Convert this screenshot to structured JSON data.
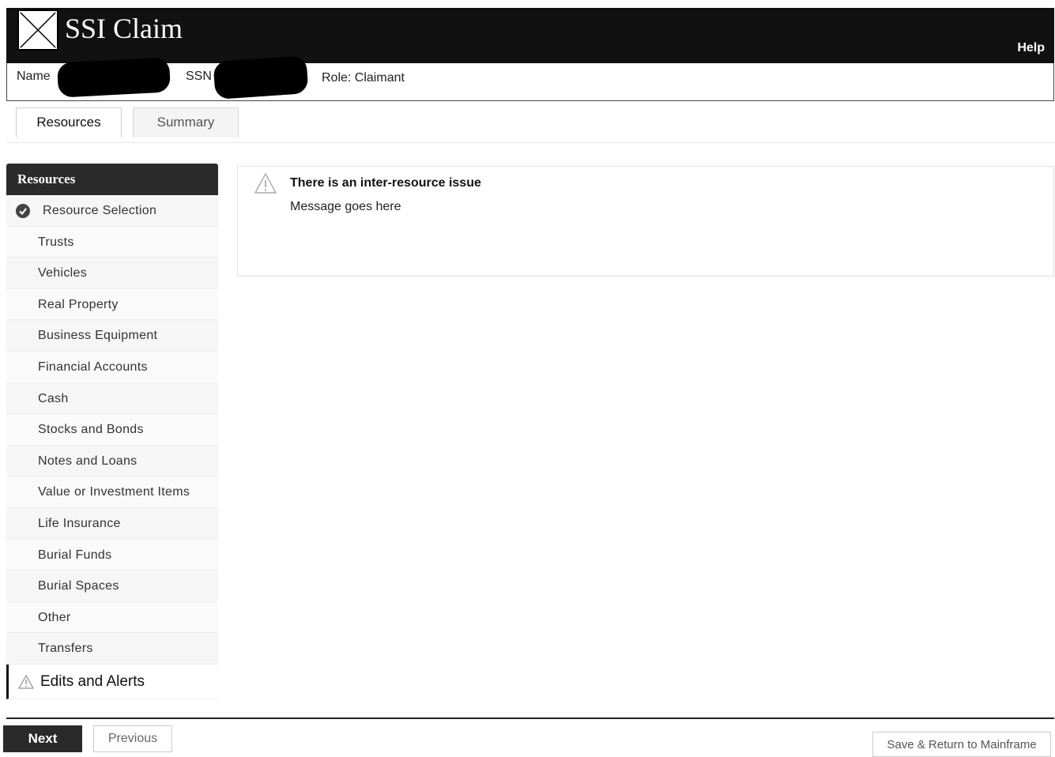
{
  "app": {
    "title": "SSI Claim",
    "help_label": "Help"
  },
  "claimant": {
    "name_label": "Name",
    "ssn_label": "SSN",
    "role_text": "Role: Claimant"
  },
  "tabs": [
    {
      "label": "Resources",
      "active": true
    },
    {
      "label": "Summary",
      "active": false
    }
  ],
  "sidebar": {
    "header": "Resources",
    "items": [
      {
        "label": "Resource Selection",
        "icon": "check-circle-icon"
      },
      {
        "label": "Trusts"
      },
      {
        "label": "Vehicles"
      },
      {
        "label": "Real Property"
      },
      {
        "label": "Business Equipment"
      },
      {
        "label": "Financial Accounts"
      },
      {
        "label": "Cash"
      },
      {
        "label": "Stocks and Bonds"
      },
      {
        "label": "Notes and Loans"
      },
      {
        "label": "Value or Investment Items"
      },
      {
        "label": "Life Insurance"
      },
      {
        "label": "Burial Funds"
      },
      {
        "label": "Burial Spaces"
      },
      {
        "label": "Other"
      },
      {
        "label": "Transfers"
      }
    ],
    "edits": {
      "label": "Edits and Alerts",
      "icon": "warning-icon"
    }
  },
  "message": {
    "title": "There is an inter-resource issue",
    "body": "Message goes here",
    "icon": "warning-icon"
  },
  "footer": {
    "next_label": "Next",
    "previous_label": "Previous",
    "save_label": "Save & Return to Mainframe"
  },
  "colors": {
    "header_bg": "#111111",
    "sidebar_header_bg": "#2b2b2b",
    "next_button_bg": "#2a2a2a"
  }
}
